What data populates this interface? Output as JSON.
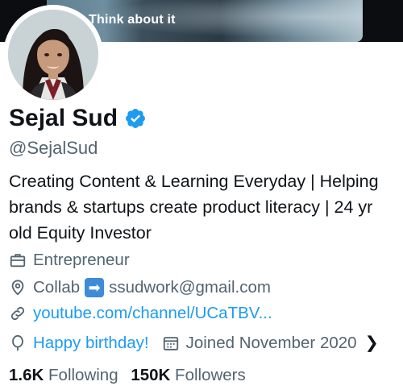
{
  "banner": {
    "text": "Think about it"
  },
  "profile": {
    "name": "Sejal Sud",
    "handle": "@SejalSud",
    "bio": "Creating Content & Learning Everyday | Helping brands & startups create product literacy | 24 yr old Equity Investor",
    "category": "Entrepreneur",
    "location_prefix": "Collab",
    "location_email": "ssudwork@gmail.com",
    "website": "youtube.com/channel/UCaTBV...",
    "birthday": "Happy birthday!",
    "joined": "Joined November 2020",
    "chevron": "❯",
    "arrow_emoji": "➡"
  },
  "stats": {
    "following_count": "1.6K",
    "following_label": "Following",
    "followers_count": "150K",
    "followers_label": "Followers"
  },
  "colors": {
    "link": "#1d9bf0",
    "muted": "#536471",
    "text": "#0f1419",
    "verified": "#1d9bf0"
  }
}
